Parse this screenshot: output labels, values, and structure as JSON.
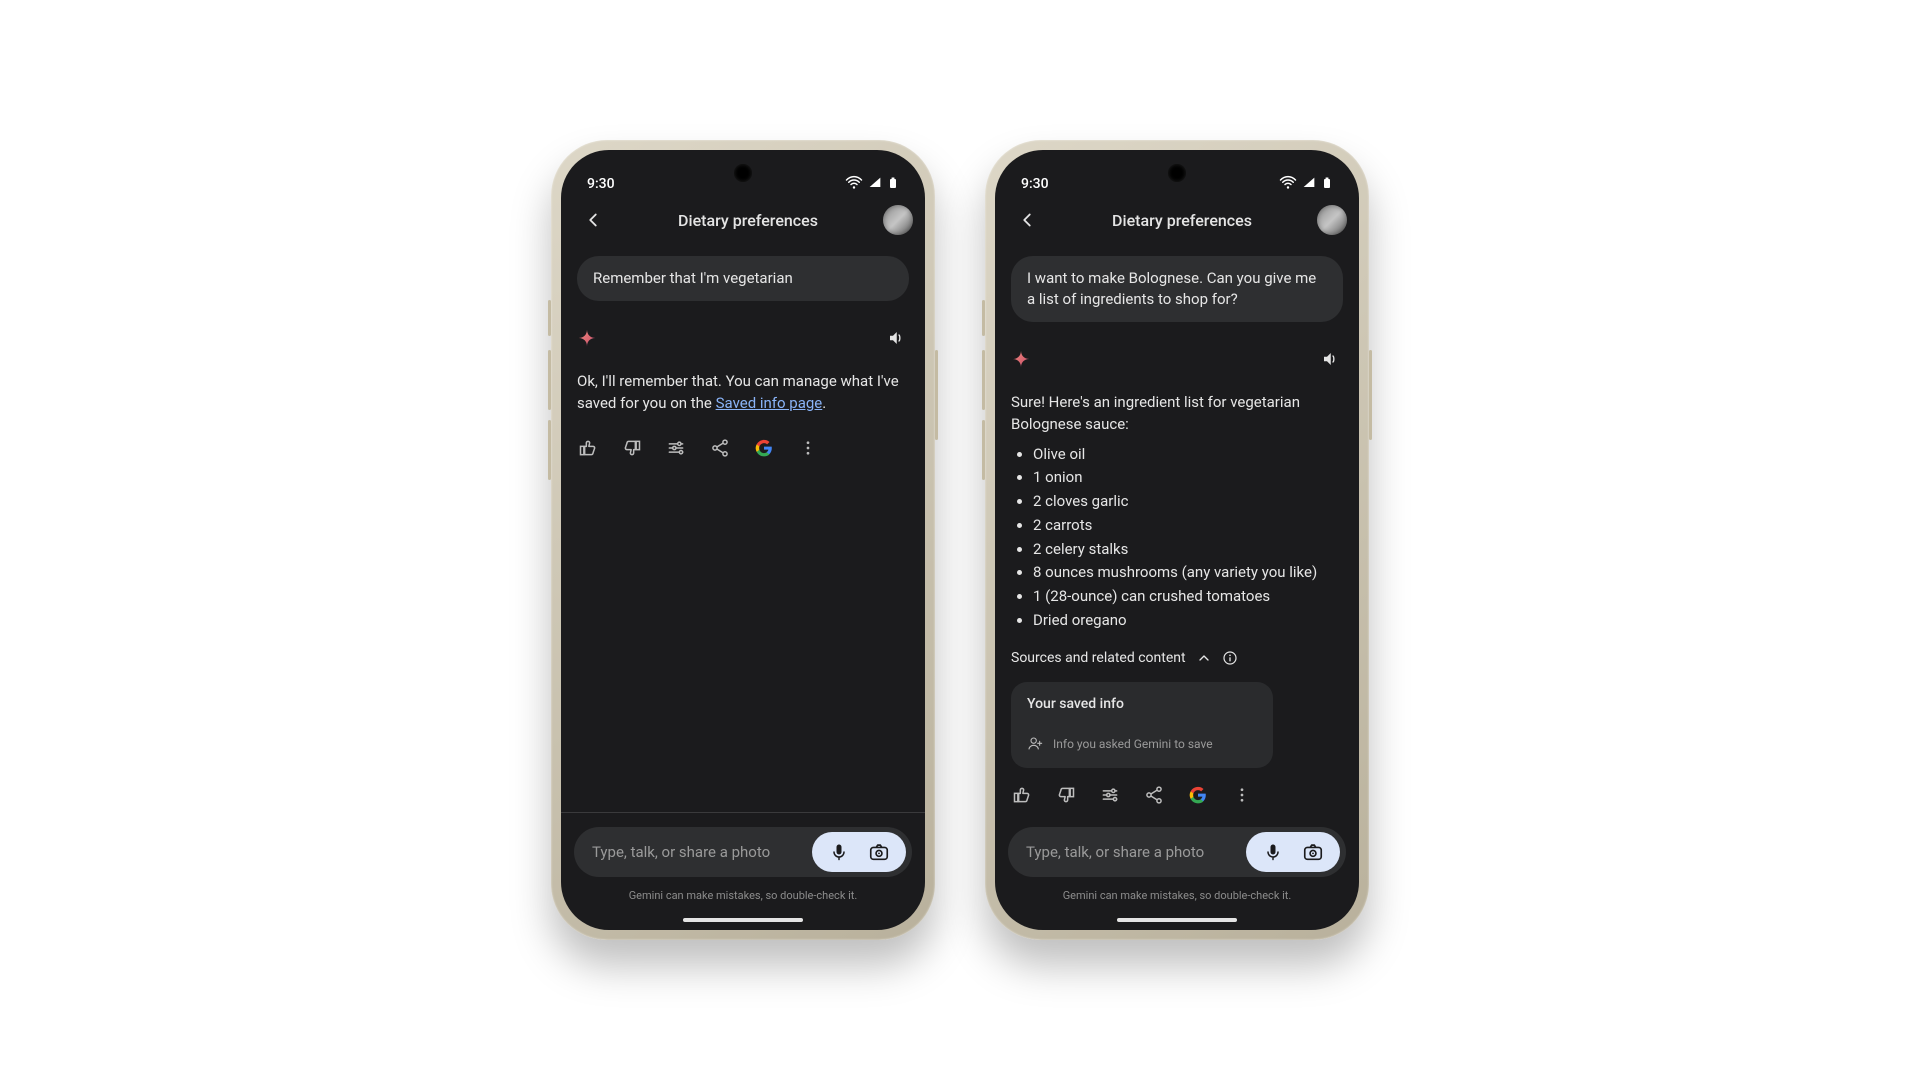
{
  "status": {
    "time": "9:30"
  },
  "header": {
    "title": "Dietary preferences"
  },
  "p1": {
    "user_msg": "Remember that I'm vegetarian",
    "reply_pre": "Ok, I'll remember that. You can manage what I've saved for you on the ",
    "reply_link": "Saved info page",
    "reply_post": "."
  },
  "p2": {
    "user_msg": "I want to make Bolognese. Can you give me a list of ingredients to shop for?",
    "reply_intro": "Sure! Here's an ingredient list for vegetarian Bolognese sauce:",
    "ingredients": [
      "Olive oil",
      "1 onion",
      "2 cloves garlic",
      "2 carrots",
      "2 celery stalks",
      "8 ounces mushrooms (any variety you like)",
      "1 (28-ounce) can crushed tomatoes",
      "Dried oregano"
    ],
    "sources_label": "Sources and related content",
    "saved_card": {
      "title": "Your saved info",
      "sub": "Info you asked Gemini to save"
    }
  },
  "input": {
    "placeholder": "Type, talk, or share a photo",
    "disclaimer": "Gemini can make mistakes, so double-check it."
  }
}
